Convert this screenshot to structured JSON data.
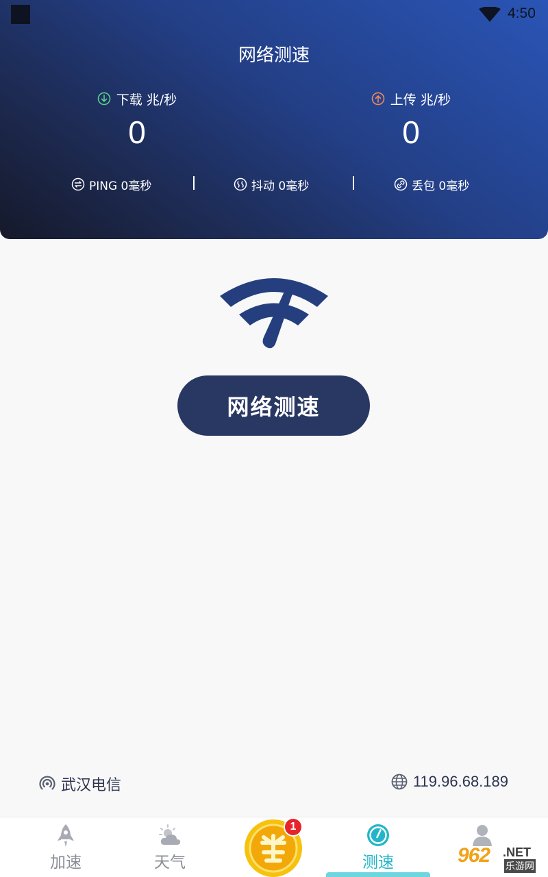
{
  "status_bar": {
    "time": "4:50",
    "icons": [
      "app-square-icon",
      "wifi-icon"
    ]
  },
  "header": {
    "title": "网络测速",
    "download": {
      "label": "下载 兆/秒",
      "value": "0",
      "icon": "download-arrow-icon",
      "icon_color": "#5bd08a"
    },
    "upload": {
      "label": "上传 兆/秒",
      "value": "0",
      "icon": "upload-arrow-icon",
      "icon_color": "#f08a5a"
    },
    "stats": {
      "ping": {
        "label": "PING 0毫秒",
        "icon": "ping-icon"
      },
      "jitter": {
        "label": "抖动 0毫秒",
        "icon": "jitter-icon"
      },
      "loss": {
        "label": "丢包 0毫秒",
        "icon": "link-icon"
      }
    },
    "gradient_colors": [
      "#2a55b6",
      "#15192a"
    ]
  },
  "main": {
    "logo_icon": "speed-gauge-icon",
    "logo_color": "#253f7e",
    "test_button_label": "网络测速",
    "button_color": "#293763",
    "isp": {
      "name": "武汉电信",
      "icon": "signal-icon"
    },
    "ip": {
      "address": "119.96.68.189",
      "icon": "globe-icon"
    }
  },
  "bottom_nav": {
    "items": [
      {
        "label": "加速",
        "icon": "rocket-icon",
        "active": false
      },
      {
        "label": "天气",
        "icon": "weather-icon",
        "active": false
      },
      {
        "label": "",
        "icon": "reward-coin-icon",
        "badge": "1"
      },
      {
        "label": "测速",
        "icon": "speedometer-icon",
        "active": true
      },
      {
        "label": "",
        "icon": "profile-icon",
        "active": false
      }
    ],
    "active_color": "#23b6c8"
  },
  "watermark": {
    "number": "962",
    "suffix": ".NET",
    "cn": "乐游网"
  }
}
